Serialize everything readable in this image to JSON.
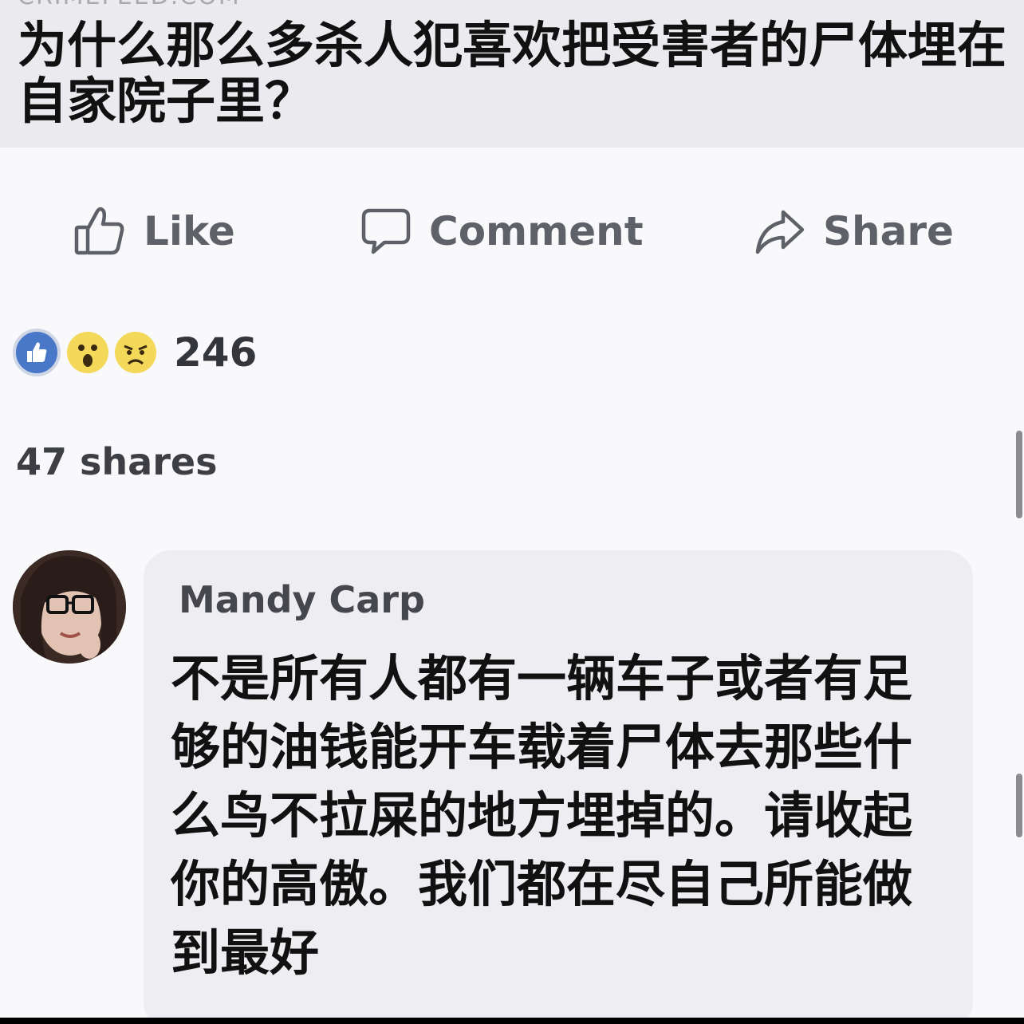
{
  "post": {
    "link_domain": "CRIMEFEED.COM",
    "link_title": "为什么那么多杀人犯喜欢把受害者的尸体埋在自家院子里？"
  },
  "actions": {
    "like_label": "Like",
    "comment_label": "Comment",
    "share_label": "Share"
  },
  "reactions": {
    "count": "246",
    "types": [
      "like-icon",
      "wow-icon",
      "sad-icon"
    ]
  },
  "shares_text": "47 shares",
  "comment": {
    "author": "Mandy Carp",
    "text": "不是所有人都有一辆车子或者有足够的油钱能开车载着尸体去那些什么鸟不拉屎的地方埋掉的。请收起你的高傲。我们都在尽自己所能做到最好"
  },
  "colors": {
    "like_blue": "#4a78c8",
    "emoji_yellow": "#f3d85a",
    "action_gray": "#5f6168"
  }
}
